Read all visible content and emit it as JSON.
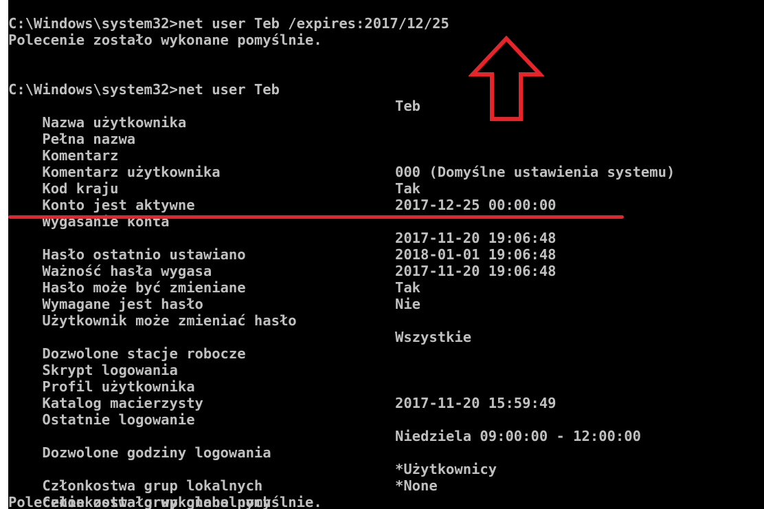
{
  "console": {
    "cmd1": "C:\\Windows\\system32>net user Teb /expires:2017/12/25",
    "success1": "Polecenie zostało wykonane pomyślnie.",
    "cmd2": "C:\\Windows\\system32>net user Teb",
    "rows": [
      {
        "key": "Nazwa użytkownika",
        "value": "Teb"
      },
      {
        "key": "Pełna nazwa",
        "value": ""
      },
      {
        "key": "Komentarz",
        "value": ""
      },
      {
        "key": "Komentarz użytkownika",
        "value": ""
      },
      {
        "key": "Kod kraju",
        "value": "000 (Domyślne ustawienia systemu)"
      },
      {
        "key": "Konto jest aktywne",
        "value": "Tak"
      },
      {
        "key": "Wygasanie konta",
        "value": "2017-12-25 00:00:00"
      },
      {
        "key": "Hasło ostatnio ustawiano",
        "value": "2017-11-20 19:06:48"
      },
      {
        "key": "Ważność hasła wygasa",
        "value": "2018-01-01 19:06:48"
      },
      {
        "key": "Hasło może być zmieniane",
        "value": "2017-11-20 19:06:48"
      },
      {
        "key": "Wymagane jest hasło",
        "value": "Tak"
      },
      {
        "key": "Użytkownik może zmieniać hasło",
        "value": "Nie"
      },
      {
        "key": "Dozwolone stacje robocze",
        "value": "Wszystkie"
      },
      {
        "key": "Skrypt logowania",
        "value": ""
      },
      {
        "key": "Profil użytkownika",
        "value": ""
      },
      {
        "key": "Katalog macierzysty",
        "value": ""
      },
      {
        "key": "Ostatnie logowanie",
        "value": "2017-11-20 15:59:49"
      },
      {
        "key": "Dozwolone godziny logowania",
        "value": "Niedziela 09:00:00 - 12:00:00"
      },
      {
        "key": "Członkostwa grup lokalnych",
        "value": "*Użytkownicy"
      },
      {
        "key": "Członkostwa grup globalnych",
        "value": "*None"
      }
    ],
    "success2": "Polecenie zostało wykonane pomyślnie."
  },
  "annotations": {
    "arrow_icon": "up-arrow-icon",
    "arrow_color": "#e8242b",
    "underline_color": "#e8242b"
  },
  "colors": {
    "background": "#000000",
    "text": "#c0c0c0"
  }
}
